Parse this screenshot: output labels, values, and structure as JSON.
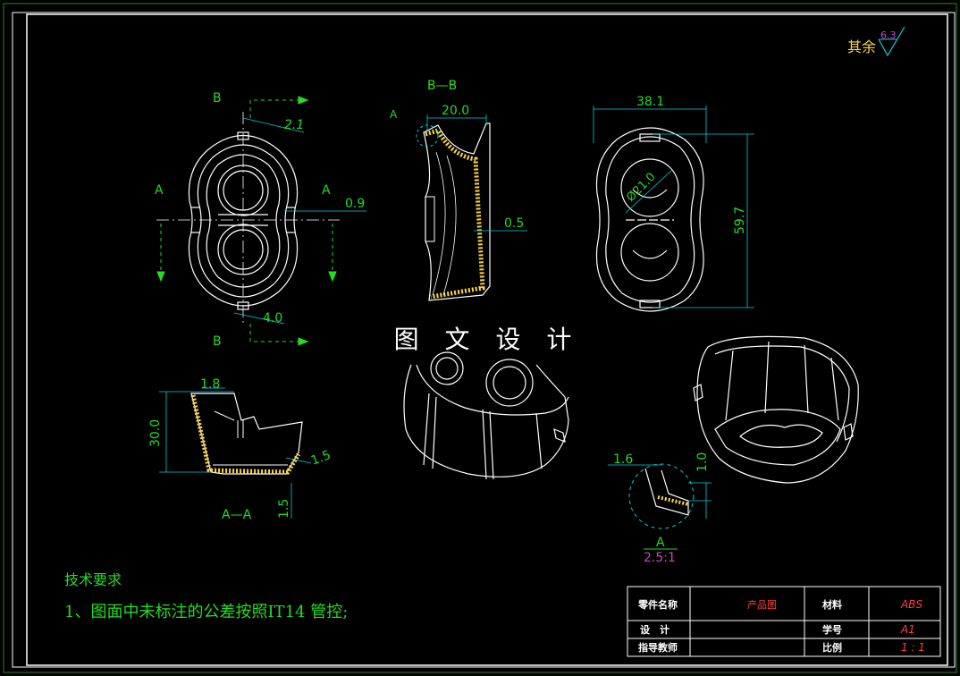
{
  "watermark": "图 文 设 计",
  "roughness": {
    "label": "其余",
    "value": "6.3"
  },
  "section_labels": {
    "b_top": "B",
    "b_bottom": "B",
    "a_left": "A",
    "a_right": "A",
    "bb": "B—B",
    "detail_a": "A",
    "aa": "A—A",
    "detail_name": "A",
    "detail_scale": "2.5:1"
  },
  "dimensions": {
    "d_2_1": "2.1",
    "d_0_9": "0.9",
    "d_4_0": "4.0",
    "d_20_0": "20.0",
    "d_0_5": "0.5",
    "d_38_1": "38.1",
    "d_59_7": "59.7",
    "d_dia21": "Ø21.0",
    "d_1_8": "1.8",
    "d_30_0": "30.0",
    "d_1_5a": "1.5",
    "d_1_5b": "1.5",
    "d_1_6": "1.6",
    "d_1_0": "1.0"
  },
  "tech_notes": {
    "title": "技术要求",
    "line1": "1、图面中未标注的公差按照IT14 管控;"
  },
  "title_block": {
    "part_name_label": "零件名称",
    "part_name": "产品图",
    "material_label": "材料",
    "material": "ABS",
    "design_label": "设　计",
    "student_id_label": "学号",
    "student_id": "A1",
    "advisor_label": "指导教师",
    "scale_label": "比例",
    "scale": "1 : 1"
  },
  "colors": {
    "dim": "#22dd22",
    "cyan": "#00d0e0",
    "yellow": "#ffd24a",
    "red": "#ff4040",
    "magenta": "#d040d0"
  }
}
